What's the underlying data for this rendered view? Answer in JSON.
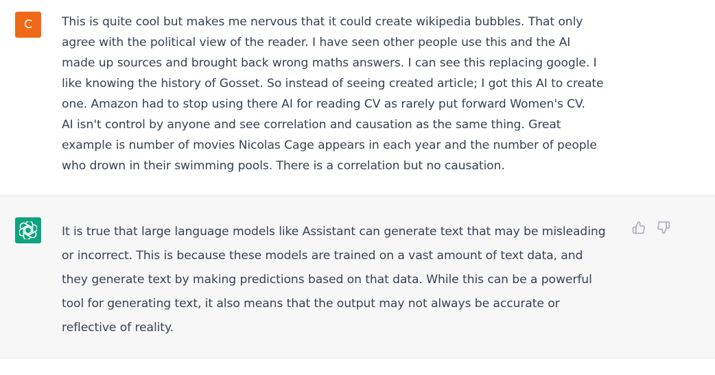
{
  "user_message": {
    "avatar_letter": "C",
    "avatar_color": "#ee6a18",
    "text": "This is quite cool but makes me nervous that it could create wikipedia bubbles. That only\nagree with the political view of the reader. I have seen other people use this and the AI\nmade up sources and brought back wrong maths answers. I can see this replacing google. I\nlike knowing the history of Gosset. So instead of seeing created article; I got this AI to create\none. Amazon had to stop using there AI for reading CV as rarely put forward Women's CV.\nAI isn't control by anyone and see correlation and causation as the same thing. Great\nexample is number of movies Nicolas Cage appears in each year and the number of people\nwho drown in their swimming pools. There is a correlation but no causation."
  },
  "assistant_message": {
    "avatar_icon": "openai-logo-icon",
    "avatar_color": "#10a37f",
    "text": "It is true that large language models like Assistant can generate text that may be misleading\nor incorrect. This is because these models are trained on a vast amount of text data, and\nthey generate text by making predictions based on that data. While this can be a powerful\ntool for generating text, it also means that the output may not always be accurate or\nreflective of reality.",
    "feedback": {
      "thumbs_up_icon": "thumbs-up-icon",
      "thumbs_down_icon": "thumbs-down-icon"
    }
  },
  "colors": {
    "text": "#374151",
    "assistant_background": "#f7f7f8",
    "divider": "#e5e7eb",
    "icon": "#acacbe"
  }
}
